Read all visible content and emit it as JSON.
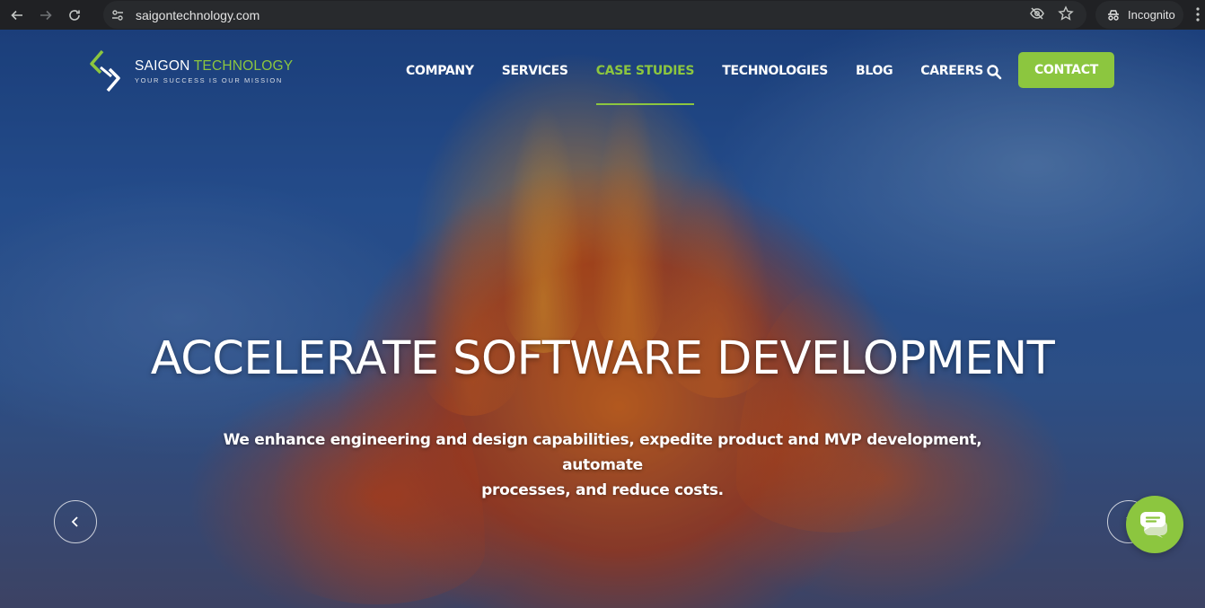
{
  "browser": {
    "url": "saigontechnology.com",
    "incognito_label": "Incognito"
  },
  "site": {
    "logo": {
      "name_primary": "SAIGON",
      "name_accent": "TECHNOLOGY",
      "tagline": "YOUR SUCCESS IS OUR MISSION"
    },
    "nav": {
      "items": [
        {
          "label": "COMPANY",
          "active": false
        },
        {
          "label": "SERVICES",
          "active": false
        },
        {
          "label": "CASE STUDIES",
          "active": true
        },
        {
          "label": "TECHNOLOGIES",
          "active": false
        },
        {
          "label": "BLOG",
          "active": false
        },
        {
          "label": "CAREERS",
          "active": false
        }
      ],
      "contact_label": "CONTACT"
    }
  },
  "hero": {
    "title": "ACCELERATE SOFTWARE DEVELOPMENT",
    "subtitle_line1": "We enhance engineering and design capabilities, expedite product and MVP development, automate",
    "subtitle_line2": "processes, and reduce costs."
  },
  "colors": {
    "accent_green": "#8cc63f",
    "chrome_bg": "#202124"
  },
  "icons": [
    "back-icon",
    "forward-icon",
    "reload-icon",
    "site-info-icon",
    "eye-off-icon",
    "star-icon",
    "incognito-icon",
    "menu-icon",
    "search-icon",
    "chevron-left-icon",
    "chevron-right-icon",
    "chat-icon"
  ]
}
